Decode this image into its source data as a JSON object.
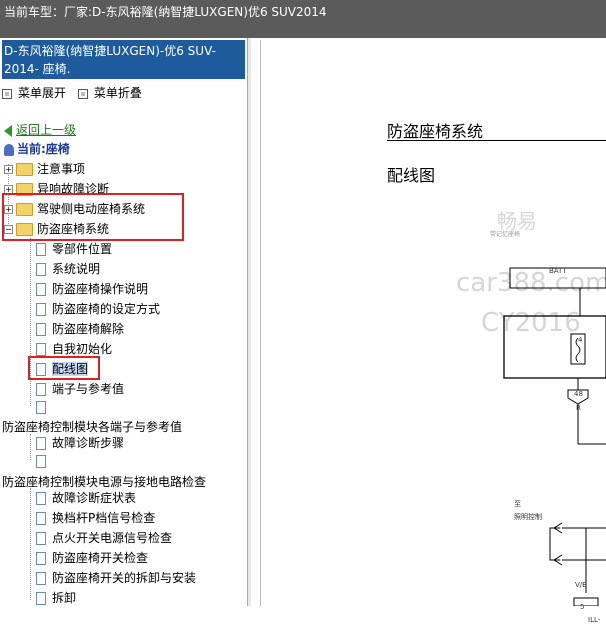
{
  "header": {
    "label": "当前车型：",
    "vehicle": "厂家:D-东风裕隆(纳智捷LUXGEN)优6 SUV2014"
  },
  "sidebar": {
    "title": "D-东风裕隆(纳智捷LUXGEN)-优6 SUV-2014- 座椅.",
    "expand_all": "菜单展开",
    "collapse_all": "菜单折叠",
    "back": "返回上一级",
    "current": "当前:座椅",
    "folders": [
      {
        "label": "注意事项"
      },
      {
        "label": "异响故障诊断"
      },
      {
        "label": "驾驶侧电动座椅系统"
      },
      {
        "label": "防盗座椅系统"
      }
    ],
    "items": [
      {
        "label": "零部件位置"
      },
      {
        "label": "系统说明"
      },
      {
        "label": "防盗座椅操作说明"
      },
      {
        "label": "防盗座椅的设定方式"
      },
      {
        "label": "防盗座椅解除"
      },
      {
        "label": "自我初始化"
      },
      {
        "label": "配线图"
      },
      {
        "label": "端子与参考值"
      },
      {
        "label": ""
      }
    ],
    "group1": {
      "label": "防盗座椅控制模块各端子与参考值",
      "items": [
        {
          "label": "故障诊断步骤"
        },
        {
          "label": ""
        }
      ]
    },
    "group2": {
      "label": "防盗座椅控制模块电源与接地电路检查",
      "items": [
        {
          "label": "故障诊断症状表"
        },
        {
          "label": "换档杆P档信号检查"
        },
        {
          "label": "点火开关电源信号检查"
        },
        {
          "label": "防盗座椅开关检查"
        },
        {
          "label": "防盗座椅开关的拆卸与安装"
        },
        {
          "label": "拆卸"
        }
      ]
    }
  },
  "content": {
    "section_title": "防盗座椅系统",
    "subtitle": "配线图",
    "watermark": {
      "line1": "畅易",
      "line2": "car388.com",
      "line3": "CY2016"
    },
    "diagram": {
      "label_batt": "BATT",
      "label_48": "48",
      "label_r": "R",
      "label_zhi": "至",
      "label_light": "照明控制",
      "label_vb": "V/B",
      "label_5": "5",
      "label_ill": "ILL-",
      "label_4": "4",
      "label_small": "带记忆座椅"
    }
  }
}
